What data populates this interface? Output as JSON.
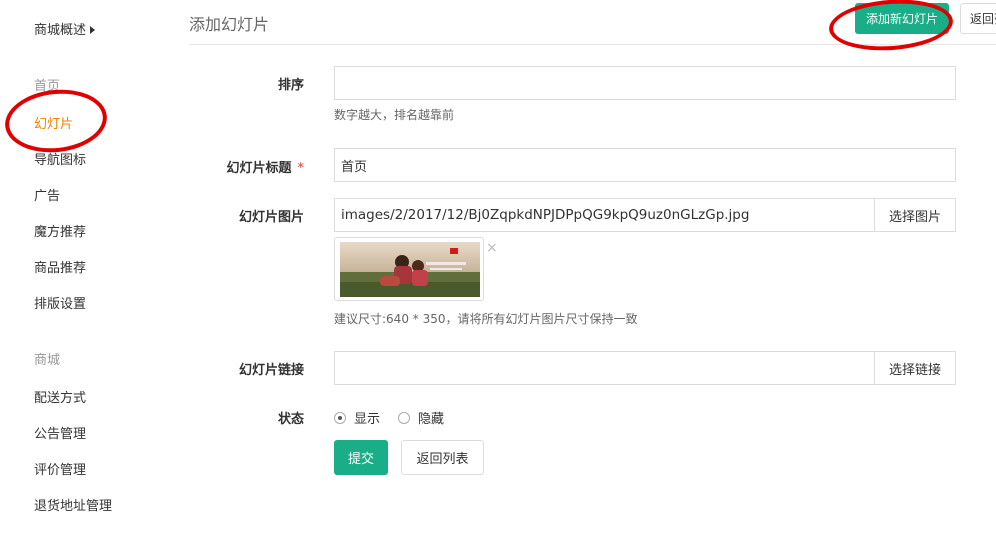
{
  "sidebar": {
    "overview": "商城概述",
    "group_home": "首页",
    "items_home": [
      "幻灯片",
      "导航图标",
      "广告",
      "魔方推荐",
      "商品推荐",
      "排版设置"
    ],
    "group_shop": "商城",
    "items_shop": [
      "配送方式",
      "公告管理",
      "评价管理",
      "退货地址管理"
    ]
  },
  "header": {
    "title": "添加幻灯片",
    "add_button": "添加新幻灯片",
    "back_button": "返回列表"
  },
  "form": {
    "sort_label": "排序",
    "sort_value": "",
    "sort_help": "数字越大，排名越靠前",
    "title_label": "幻灯片标题",
    "title_required": "*",
    "title_value": "首页",
    "image_label": "幻灯片图片",
    "image_value": "images/2/2017/12/Bj0ZqpkdNPJDPpQG9kpQ9uz0nGLzGp.jpg",
    "image_button": "选择图片",
    "image_remove": "×",
    "image_help": "建议尺寸:640 * 350，请将所有幻灯片图片尺寸保持一致",
    "link_label": "幻灯片链接",
    "link_value": "",
    "link_button": "选择链接",
    "status_label": "状态",
    "status_options": [
      "显示",
      "隐藏"
    ],
    "status_selected": "显示",
    "submit_button": "提交",
    "back_button": "返回列表"
  },
  "colors": {
    "accent": "#1aae88",
    "active": "#f08200",
    "annotation": "#e00000"
  }
}
